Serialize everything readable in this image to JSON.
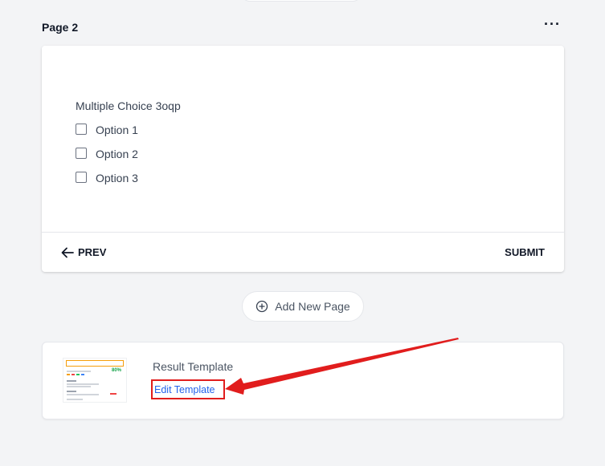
{
  "page": {
    "title": "Page 2",
    "more_label": "···"
  },
  "question": {
    "label": "Multiple Choice 3oqp",
    "options": [
      "Option 1",
      "Option 2",
      "Option 3"
    ]
  },
  "footer": {
    "prev_label": "PREV",
    "submit_label": "SUBMIT"
  },
  "add_page": {
    "label": "Add New Page"
  },
  "result_template": {
    "title": "Result Template",
    "edit_label": "Edit Template"
  },
  "colors": {
    "accent": "#2563eb",
    "annotation": "#e11d1d",
    "background": "#f3f4f6"
  },
  "icons": {
    "prev": "arrow-left-icon",
    "add_page": "plus-circle-icon",
    "more": "more-horizontal-icon"
  }
}
